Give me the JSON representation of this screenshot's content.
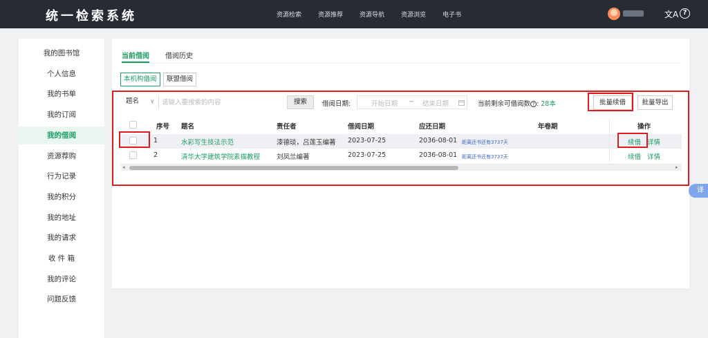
{
  "header": {
    "logo": "统一检索系统",
    "nav": [
      "资源检索",
      "资源推荐",
      "资源导航",
      "资源浏览",
      "电子书"
    ],
    "lang_glyph": "文A",
    "help_glyph": "?"
  },
  "sidebar": {
    "items": [
      {
        "label": "我的图书馆",
        "active": false
      },
      {
        "label": "个人信息",
        "active": false
      },
      {
        "label": "我的书单",
        "active": false
      },
      {
        "label": "我的订阅",
        "active": false
      },
      {
        "label": "我的借阅",
        "active": true
      },
      {
        "label": "资源荐购",
        "active": false
      },
      {
        "label": "行为记录",
        "active": false
      },
      {
        "label": "我的积分",
        "active": false
      },
      {
        "label": "我的地址",
        "active": false
      },
      {
        "label": "我的请求",
        "active": false
      },
      {
        "label": "收 件 箱",
        "active": false
      },
      {
        "label": "我的评论",
        "active": false
      },
      {
        "label": "问题反馈",
        "active": false
      }
    ]
  },
  "tabs": {
    "current": "当前借阅",
    "history": "借阅历史"
  },
  "subtabs": {
    "local": "本机构借阅",
    "union": "联盟借阅"
  },
  "search": {
    "field": "题名",
    "placeholder": "请输入要搜索的内容",
    "button": "搜索",
    "date_label": "借阅日期:",
    "start_placeholder": "开始日期",
    "separator": "~",
    "end_placeholder": "结束日期",
    "quota_label": "当前剩余可借阅数",
    "quota_colon": ":",
    "quota_value": "28本",
    "batch_renew": "批量续借",
    "batch_export": "批量导出"
  },
  "table": {
    "headers": {
      "index": "序号",
      "title": "题名",
      "author": "责任者",
      "borrow_date": "借阅日期",
      "due_date": "应还日期",
      "volume": "年卷期",
      "actions": "操作"
    },
    "rows": [
      {
        "index": "1",
        "title": "水彩写生技法示范",
        "author": "漆德琰，吕莲玉编著",
        "borrow_date": "2023-07-25",
        "due_date": "2036-08-01",
        "remain": "距离还书还有3737天",
        "renew": "续借",
        "detail": "详情"
      },
      {
        "index": "2",
        "title": "清华大学建筑学院素描教程",
        "author": "刘凤兰编著",
        "borrow_date": "2023-07-25",
        "due_date": "2036-08-01",
        "remain": "距离还书还有3737天",
        "renew": "续借",
        "detail": "详情"
      }
    ]
  },
  "translate_fab": "译",
  "colors": {
    "accent": "#1a9d63",
    "highlight": "#e0191e",
    "header_bg": "#262b34"
  }
}
